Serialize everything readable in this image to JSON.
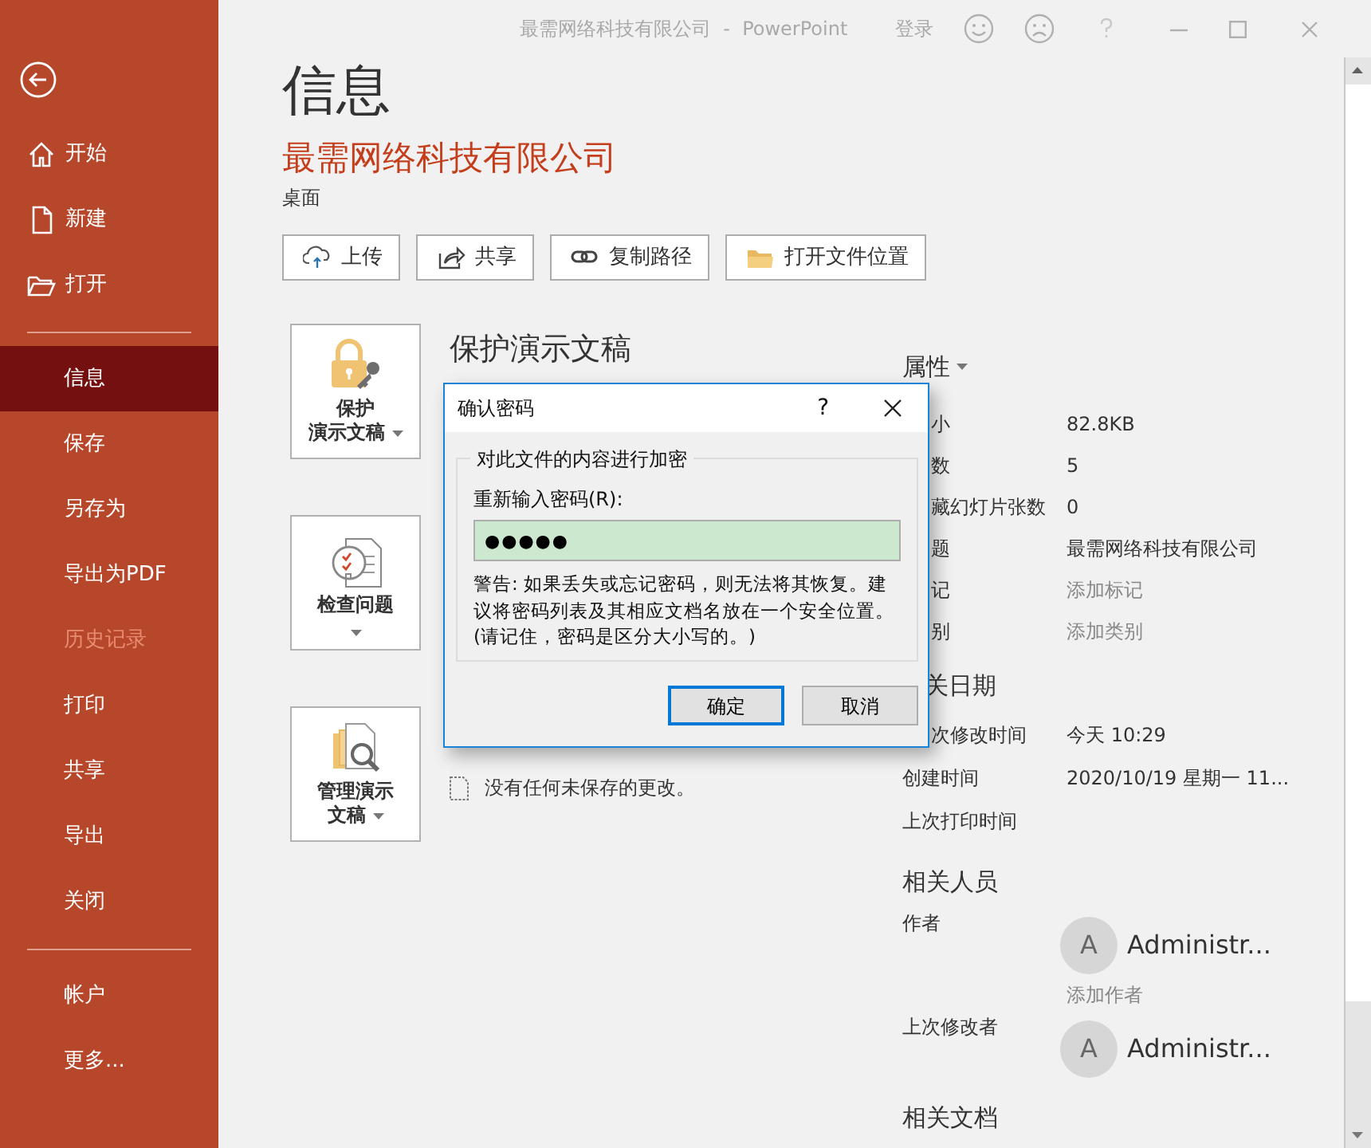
{
  "window": {
    "title": "最需网络科技有限公司  -  PowerPoint",
    "sign_in": "登录"
  },
  "sidebar": {
    "groups": [
      [
        {
          "label": "开始",
          "kind": "home",
          "selected": false,
          "disabled": false
        },
        {
          "label": "新建",
          "kind": "new",
          "selected": false,
          "disabled": false
        },
        {
          "label": "打开",
          "kind": "open",
          "selected": false,
          "disabled": false
        }
      ],
      [
        {
          "label": "信息",
          "kind": "plain",
          "selected": true,
          "disabled": false
        },
        {
          "label": "保存",
          "kind": "plain",
          "selected": false,
          "disabled": false
        },
        {
          "label": "另存为",
          "kind": "plain",
          "selected": false,
          "disabled": false
        },
        {
          "label": "导出为PDF",
          "kind": "plain",
          "selected": false,
          "disabled": false
        },
        {
          "label": "历史记录",
          "kind": "plain",
          "selected": false,
          "disabled": true
        },
        {
          "label": "打印",
          "kind": "plain",
          "selected": false,
          "disabled": false
        },
        {
          "label": "共享",
          "kind": "plain",
          "selected": false,
          "disabled": false
        },
        {
          "label": "导出",
          "kind": "plain",
          "selected": false,
          "disabled": false
        },
        {
          "label": "关闭",
          "kind": "plain",
          "selected": false,
          "disabled": false
        }
      ],
      [
        {
          "label": "帐户",
          "kind": "plain",
          "selected": false,
          "disabled": false
        },
        {
          "label": "更多...",
          "kind": "plain",
          "selected": false,
          "disabled": false
        }
      ]
    ]
  },
  "page": {
    "title": "信息",
    "file_name": "最需网络科技有限公司",
    "location": "桌面",
    "actions": [
      {
        "label": "上传",
        "kind": "upload"
      },
      {
        "label": "共享",
        "kind": "share"
      },
      {
        "label": "复制路径",
        "kind": "link"
      },
      {
        "label": "打开文件位置",
        "kind": "folder"
      }
    ]
  },
  "sections": [
    {
      "kind": "protect",
      "button": [
        "保护",
        "演示文稿"
      ],
      "heading": "保护演示文稿"
    },
    {
      "kind": "inspect",
      "button": [
        "检查问题"
      ]
    },
    {
      "kind": "manage",
      "button": [
        "管理演示",
        "文稿"
      ],
      "notes": [
        "没有任何未保存的更改。"
      ]
    }
  ],
  "properties": {
    "title": "属性",
    "rows": [
      {
        "label": "小",
        "value": "82.8KB",
        "cut": true,
        "kind": "text"
      },
      {
        "label": "数",
        "value": "5",
        "cut": true,
        "kind": "text"
      },
      {
        "label": "藏幻灯片张数",
        "value": "0",
        "cut": true,
        "kind": "text"
      },
      {
        "label": "题",
        "value": "最需网络科技有限公司",
        "cut": true,
        "kind": "text"
      },
      {
        "label": "记",
        "value": "添加标记",
        "cut": true,
        "kind": "placeholder"
      },
      {
        "label": "别",
        "value": "添加类别",
        "cut": true,
        "kind": "placeholder"
      }
    ]
  },
  "dates": {
    "title": "关日期",
    "title_cut": true,
    "rows": [
      {
        "label": "次修改时间",
        "value": "今天 10:29",
        "cut": true
      },
      {
        "label": "创建时间",
        "value": "2020/10/19 星期一 11...",
        "cut": false
      },
      {
        "label": "上次打印时间",
        "cut": false
      }
    ]
  },
  "people": {
    "title": "相关人员",
    "rows": [
      {
        "label": "作者",
        "initial": "A",
        "name": "Administr...",
        "add": "添加作者"
      },
      {
        "label": "上次修改者",
        "initial": "A",
        "name": "Administr..."
      }
    ]
  },
  "documents": {
    "title": "相关文档"
  },
  "dialog": {
    "title": "确认密码",
    "help": "?",
    "group": "对此文件的内容进行加密",
    "field_label": "重新输入密码(R):",
    "value": "●●●●●",
    "warning": "警告: 如果丢失或忘记密码，则无法将其恢复。建议将密码列表及其相应文档名放在一个安全位置。(请记住，密码是区分大小写的。)",
    "buttons": [
      {
        "label": "确定",
        "default": true
      },
      {
        "label": "取消",
        "default": false
      }
    ]
  }
}
